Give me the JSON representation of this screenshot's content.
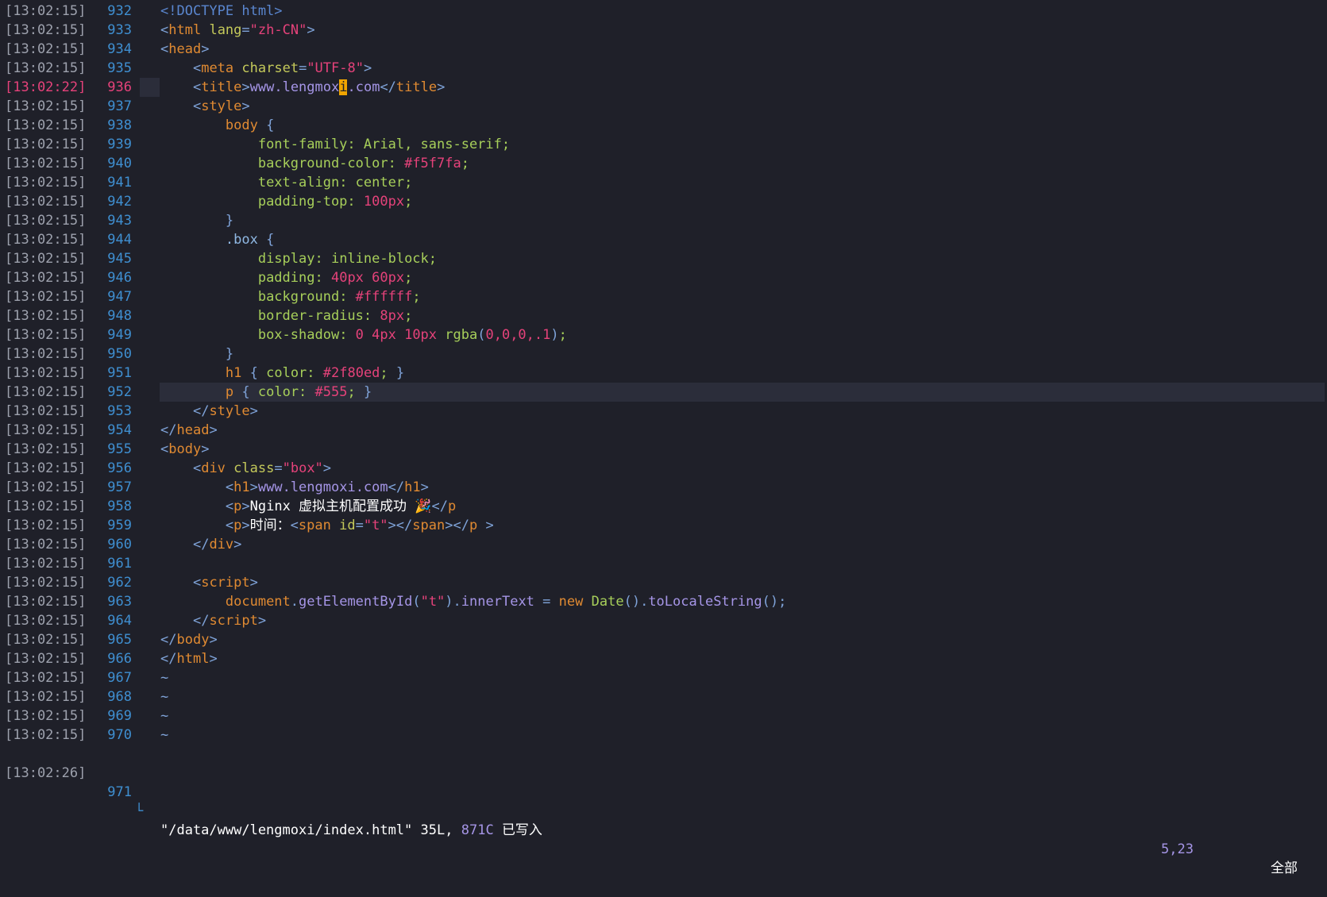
{
  "editor": {
    "lines": [
      {
        "ts": "[13:02:15]",
        "num": "932",
        "tokens": [
          [
            "doc",
            "<!DOCTYPE html>"
          ]
        ]
      },
      {
        "ts": "[13:02:15]",
        "num": "933",
        "tokens": [
          [
            "punc",
            "<"
          ],
          [
            "tag",
            "html"
          ],
          [
            "plain",
            " "
          ],
          [
            "attr",
            "lang"
          ],
          [
            "punc",
            "="
          ],
          [
            "str",
            "\"zh-CN\""
          ],
          [
            "punc",
            ">"
          ]
        ]
      },
      {
        "ts": "[13:02:15]",
        "num": "934",
        "tokens": [
          [
            "punc",
            "<"
          ],
          [
            "tag",
            "head"
          ],
          [
            "punc",
            ">"
          ]
        ]
      },
      {
        "ts": "[13:02:15]",
        "num": "935",
        "tokens": [
          [
            "plain",
            "    "
          ],
          [
            "punc",
            "<"
          ],
          [
            "tag",
            "meta"
          ],
          [
            "plain",
            " "
          ],
          [
            "attr",
            "charset"
          ],
          [
            "punc",
            "="
          ],
          [
            "str",
            "\"UTF-8\""
          ],
          [
            "punc",
            ">"
          ]
        ]
      },
      {
        "ts": "[13:02:22]",
        "num": "936",
        "active": true,
        "tokens": [
          [
            "plain",
            "    "
          ],
          [
            "punc",
            "<"
          ],
          [
            "tag",
            "title"
          ],
          [
            "punc",
            ">"
          ],
          [
            "text",
            "www.lengmox"
          ],
          [
            "cursor",
            "i"
          ],
          [
            "text",
            ".com"
          ],
          [
            "punc",
            "</"
          ],
          [
            "tag",
            "title"
          ],
          [
            "punc",
            ">"
          ]
        ]
      },
      {
        "ts": "[13:02:15]",
        "num": "937",
        "tokens": [
          [
            "plain",
            "    "
          ],
          [
            "punc",
            "<"
          ],
          [
            "tag",
            "style"
          ],
          [
            "punc",
            ">"
          ]
        ]
      },
      {
        "ts": "[13:02:15]",
        "num": "938",
        "tokens": [
          [
            "plain",
            "        "
          ],
          [
            "sel",
            "body"
          ],
          [
            "plain",
            " "
          ],
          [
            "punc",
            "{"
          ]
        ]
      },
      {
        "ts": "[13:02:15]",
        "num": "939",
        "tokens": [
          [
            "plain",
            "            "
          ],
          [
            "prop",
            "font-family"
          ],
          [
            "prop",
            ": Arial, sans-serif;"
          ]
        ]
      },
      {
        "ts": "[13:02:15]",
        "num": "940",
        "tokens": [
          [
            "plain",
            "            "
          ],
          [
            "prop",
            "background-color"
          ],
          [
            "prop",
            ": "
          ],
          [
            "num",
            "#f5f7fa"
          ],
          [
            "prop",
            ";"
          ]
        ]
      },
      {
        "ts": "[13:02:15]",
        "num": "941",
        "tokens": [
          [
            "plain",
            "            "
          ],
          [
            "prop",
            "text-align"
          ],
          [
            "prop",
            ": center;"
          ]
        ]
      },
      {
        "ts": "[13:02:15]",
        "num": "942",
        "tokens": [
          [
            "plain",
            "            "
          ],
          [
            "prop",
            "padding-top"
          ],
          [
            "prop",
            ": "
          ],
          [
            "num",
            "100px"
          ],
          [
            "prop",
            ";"
          ]
        ]
      },
      {
        "ts": "[13:02:15]",
        "num": "943",
        "tokens": [
          [
            "plain",
            "        "
          ],
          [
            "punc",
            "}"
          ]
        ]
      },
      {
        "ts": "[13:02:15]",
        "num": "944",
        "tokens": [
          [
            "plain",
            "        "
          ],
          [
            "sel2",
            ".box"
          ],
          [
            "plain",
            " "
          ],
          [
            "punc",
            "{"
          ]
        ]
      },
      {
        "ts": "[13:02:15]",
        "num": "945",
        "tokens": [
          [
            "plain",
            "            "
          ],
          [
            "prop",
            "display"
          ],
          [
            "prop",
            ": inline-block;"
          ]
        ]
      },
      {
        "ts": "[13:02:15]",
        "num": "946",
        "tokens": [
          [
            "plain",
            "            "
          ],
          [
            "prop",
            "padding"
          ],
          [
            "prop",
            ": "
          ],
          [
            "num",
            "40px 60px"
          ],
          [
            "prop",
            ";"
          ]
        ]
      },
      {
        "ts": "[13:02:15]",
        "num": "947",
        "tokens": [
          [
            "plain",
            "            "
          ],
          [
            "prop",
            "background"
          ],
          [
            "prop",
            ": "
          ],
          [
            "num",
            "#ffffff"
          ],
          [
            "prop",
            ";"
          ]
        ]
      },
      {
        "ts": "[13:02:15]",
        "num": "948",
        "tokens": [
          [
            "plain",
            "            "
          ],
          [
            "prop",
            "border-radius"
          ],
          [
            "prop",
            ": "
          ],
          [
            "num",
            "8px"
          ],
          [
            "prop",
            ";"
          ]
        ]
      },
      {
        "ts": "[13:02:15]",
        "num": "949",
        "tokens": [
          [
            "plain",
            "            "
          ],
          [
            "prop",
            "box-shadow"
          ],
          [
            "prop",
            ": "
          ],
          [
            "num",
            "0 4px 10px"
          ],
          [
            "prop",
            " "
          ],
          [
            "cls",
            "rgba"
          ],
          [
            "punc",
            "("
          ],
          [
            "num",
            "0,0,0,.1"
          ],
          [
            "punc",
            ")"
          ],
          [
            "prop",
            ";"
          ]
        ]
      },
      {
        "ts": "[13:02:15]",
        "num": "950",
        "tokens": [
          [
            "plain",
            "        "
          ],
          [
            "punc",
            "}"
          ]
        ]
      },
      {
        "ts": "[13:02:15]",
        "num": "951",
        "tokens": [
          [
            "plain",
            "        "
          ],
          [
            "sel",
            "h1"
          ],
          [
            "plain",
            " "
          ],
          [
            "punc",
            "{ "
          ],
          [
            "prop",
            "color: "
          ],
          [
            "num",
            "#2f80ed"
          ],
          [
            "prop",
            "; "
          ],
          [
            "punc",
            "}"
          ]
        ]
      },
      {
        "ts": "[13:02:15]",
        "num": "952",
        "cursorline": true,
        "tokens": [
          [
            "plain",
            "        "
          ],
          [
            "sel",
            "p"
          ],
          [
            "plain",
            " "
          ],
          [
            "punc",
            "{ "
          ],
          [
            "prop",
            "color: "
          ],
          [
            "num",
            "#555"
          ],
          [
            "prop",
            "; "
          ],
          [
            "punc",
            "}"
          ]
        ]
      },
      {
        "ts": "[13:02:15]",
        "num": "953",
        "tokens": [
          [
            "plain",
            "    "
          ],
          [
            "punc",
            "</"
          ],
          [
            "tag",
            "style"
          ],
          [
            "punc",
            ">"
          ]
        ]
      },
      {
        "ts": "[13:02:15]",
        "num": "954",
        "tokens": [
          [
            "punc",
            "</"
          ],
          [
            "tag",
            "head"
          ],
          [
            "punc",
            ">"
          ]
        ]
      },
      {
        "ts": "[13:02:15]",
        "num": "955",
        "tokens": [
          [
            "punc",
            "<"
          ],
          [
            "tag",
            "body"
          ],
          [
            "punc",
            ">"
          ]
        ]
      },
      {
        "ts": "[13:02:15]",
        "num": "956",
        "tokens": [
          [
            "plain",
            "    "
          ],
          [
            "punc",
            "<"
          ],
          [
            "tag",
            "div"
          ],
          [
            "plain",
            " "
          ],
          [
            "attr",
            "class"
          ],
          [
            "punc",
            "="
          ],
          [
            "str",
            "\"box\""
          ],
          [
            "punc",
            ">"
          ]
        ]
      },
      {
        "ts": "[13:02:15]",
        "num": "957",
        "tokens": [
          [
            "plain",
            "        "
          ],
          [
            "punc",
            "<"
          ],
          [
            "tag",
            "h1"
          ],
          [
            "punc",
            ">"
          ],
          [
            "text",
            "www.lengmoxi.com"
          ],
          [
            "punc",
            "</"
          ],
          [
            "tag",
            "h1"
          ],
          [
            "punc",
            ">"
          ]
        ]
      },
      {
        "ts": "[13:02:15]",
        "num": "958",
        "tokens": [
          [
            "plain",
            "        "
          ],
          [
            "punc",
            "<"
          ],
          [
            "tag",
            "p"
          ],
          [
            "punc",
            ">"
          ],
          [
            "plain",
            "Nginx 虚拟主机配置成功 🎉"
          ],
          [
            "punc",
            "</"
          ],
          [
            "tag",
            "p"
          ]
        ]
      },
      {
        "ts": "[13:02:15]",
        "num": "959",
        "tokens": [
          [
            "plain",
            "        "
          ],
          [
            "punc",
            "<"
          ],
          [
            "tag",
            "p"
          ],
          [
            "punc",
            ">"
          ],
          [
            "plain",
            "时间："
          ],
          [
            "punc",
            "<"
          ],
          [
            "tag",
            "span"
          ],
          [
            "plain",
            " "
          ],
          [
            "attr",
            "id"
          ],
          [
            "punc",
            "="
          ],
          [
            "str",
            "\"t\""
          ],
          [
            "punc",
            "></"
          ],
          [
            "tag",
            "span"
          ],
          [
            "punc",
            "></"
          ],
          [
            "tag",
            "p"
          ],
          [
            "plain",
            " "
          ],
          [
            "punc",
            ">"
          ]
        ]
      },
      {
        "ts": "[13:02:15]",
        "num": "960",
        "tokens": [
          [
            "plain",
            "    "
          ],
          [
            "punc",
            "</"
          ],
          [
            "tag",
            "div"
          ],
          [
            "punc",
            ">"
          ]
        ]
      },
      {
        "ts": "[13:02:15]",
        "num": "961",
        "tokens": []
      },
      {
        "ts": "[13:02:15]",
        "num": "962",
        "tokens": [
          [
            "plain",
            "    "
          ],
          [
            "punc",
            "<"
          ],
          [
            "tag",
            "script"
          ],
          [
            "punc",
            ">"
          ]
        ]
      },
      {
        "ts": "[13:02:15]",
        "num": "963",
        "tokens": [
          [
            "plain",
            "        "
          ],
          [
            "js",
            "document"
          ],
          [
            "punc",
            "."
          ],
          [
            "fn",
            "getElementById"
          ],
          [
            "punc",
            "("
          ],
          [
            "str",
            "\"t\""
          ],
          [
            "punc",
            ")"
          ],
          [
            "punc",
            "."
          ],
          [
            "fn",
            "innerText"
          ],
          [
            "plain",
            " "
          ],
          [
            "punc",
            "="
          ],
          [
            "plain",
            " "
          ],
          [
            "kw",
            "new"
          ],
          [
            "plain",
            " "
          ],
          [
            "cls",
            "Date"
          ],
          [
            "punc",
            "()."
          ],
          [
            "fn",
            "toLocaleString"
          ],
          [
            "punc",
            "();"
          ]
        ]
      },
      {
        "ts": "[13:02:15]",
        "num": "964",
        "tokens": [
          [
            "plain",
            "    "
          ],
          [
            "punc",
            "</"
          ],
          [
            "tag",
            "script"
          ],
          [
            "punc",
            ">"
          ]
        ]
      },
      {
        "ts": "[13:02:15]",
        "num": "965",
        "tokens": [
          [
            "punc",
            "</"
          ],
          [
            "tag",
            "body"
          ],
          [
            "punc",
            ">"
          ]
        ]
      },
      {
        "ts": "[13:02:15]",
        "num": "966",
        "tokens": [
          [
            "punc",
            "</"
          ],
          [
            "tag",
            "html"
          ],
          [
            "punc",
            ">"
          ]
        ]
      },
      {
        "ts": "[13:02:15]",
        "num": "967",
        "tilde": true,
        "tokens": []
      },
      {
        "ts": "[13:02:15]",
        "num": "968",
        "tilde": true,
        "tokens": []
      },
      {
        "ts": "[13:02:15]",
        "num": "969",
        "tilde": true,
        "tokens": []
      },
      {
        "ts": "[13:02:15]",
        "num": "970",
        "tilde": true,
        "tokens": []
      }
    ],
    "tilde_char": "~"
  },
  "status": {
    "ts": "[13:02:26]",
    "num": "971",
    "corner": "└",
    "file": "\"/data/www/lengmoxi/index.html\"",
    "lines_count": "35L,",
    "chars_count": "871C",
    "written": "已写入",
    "position": "5,23",
    "scroll": "全部"
  },
  "colors": {
    "background": "#1f2029",
    "line_number": "#3f8fd1",
    "active_line": "#e5427a",
    "cursor": "#f0a500"
  }
}
